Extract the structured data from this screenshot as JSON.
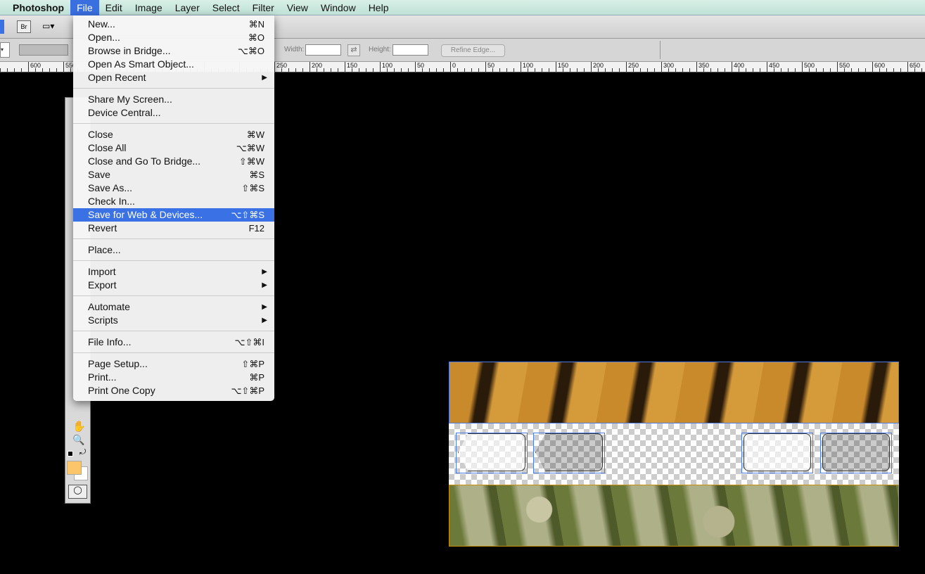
{
  "menubar": {
    "app": "Photoshop",
    "items": [
      "File",
      "Edit",
      "Image",
      "Layer",
      "Select",
      "Filter",
      "View",
      "Window",
      "Help"
    ],
    "active": "File"
  },
  "appbar": {
    "bridge_label": "Br"
  },
  "options": {
    "width_label": "Width:",
    "height_label": "Height:",
    "refine_edge": "Refine Edge..."
  },
  "ruler": {
    "labels": [
      "600",
      "550",
      "250",
      "200",
      "150",
      "100",
      "50",
      "0",
      "50",
      "100",
      "150",
      "200",
      "250",
      "300",
      "350",
      "400",
      "450",
      "500",
      "550",
      "600",
      "650"
    ]
  },
  "file_menu": [
    {
      "label": "New...",
      "shortcut": "⌘N"
    },
    {
      "label": "Open...",
      "shortcut": "⌘O"
    },
    {
      "label": "Browse in Bridge...",
      "shortcut": "⌥⌘O"
    },
    {
      "label": "Open As Smart Object...",
      "shortcut": ""
    },
    {
      "label": "Open Recent",
      "submenu": true
    },
    {
      "sep": true
    },
    {
      "label": "Share My Screen...",
      "shortcut": ""
    },
    {
      "label": "Device Central...",
      "shortcut": ""
    },
    {
      "sep": true
    },
    {
      "label": "Close",
      "shortcut": "⌘W"
    },
    {
      "label": "Close All",
      "shortcut": "⌥⌘W"
    },
    {
      "label": "Close and Go To Bridge...",
      "shortcut": "⇧⌘W"
    },
    {
      "label": "Save",
      "shortcut": "⌘S"
    },
    {
      "label": "Save As...",
      "shortcut": "⇧⌘S"
    },
    {
      "label": "Check In...",
      "shortcut": ""
    },
    {
      "label": "Save for Web & Devices...",
      "shortcut": "⌥⇧⌘S",
      "highlighted": true
    },
    {
      "label": "Revert",
      "shortcut": "F12"
    },
    {
      "sep": true
    },
    {
      "label": "Place...",
      "shortcut": ""
    },
    {
      "sep": true
    },
    {
      "label": "Import",
      "submenu": true
    },
    {
      "label": "Export",
      "submenu": true
    },
    {
      "sep": true
    },
    {
      "label": "Automate",
      "submenu": true
    },
    {
      "label": "Scripts",
      "submenu": true
    },
    {
      "sep": true
    },
    {
      "label": "File Info...",
      "shortcut": "⌥⇧⌘I"
    },
    {
      "sep": true
    },
    {
      "label": "Page Setup...",
      "shortcut": "⇧⌘P"
    },
    {
      "label": "Print...",
      "shortcut": "⌘P"
    },
    {
      "label": "Print One Copy",
      "shortcut": "⌥⇧⌘P"
    }
  ],
  "colors": {
    "foreground": "#fbc66a",
    "background": "#ffffff",
    "highlight": "#3a72e6"
  }
}
